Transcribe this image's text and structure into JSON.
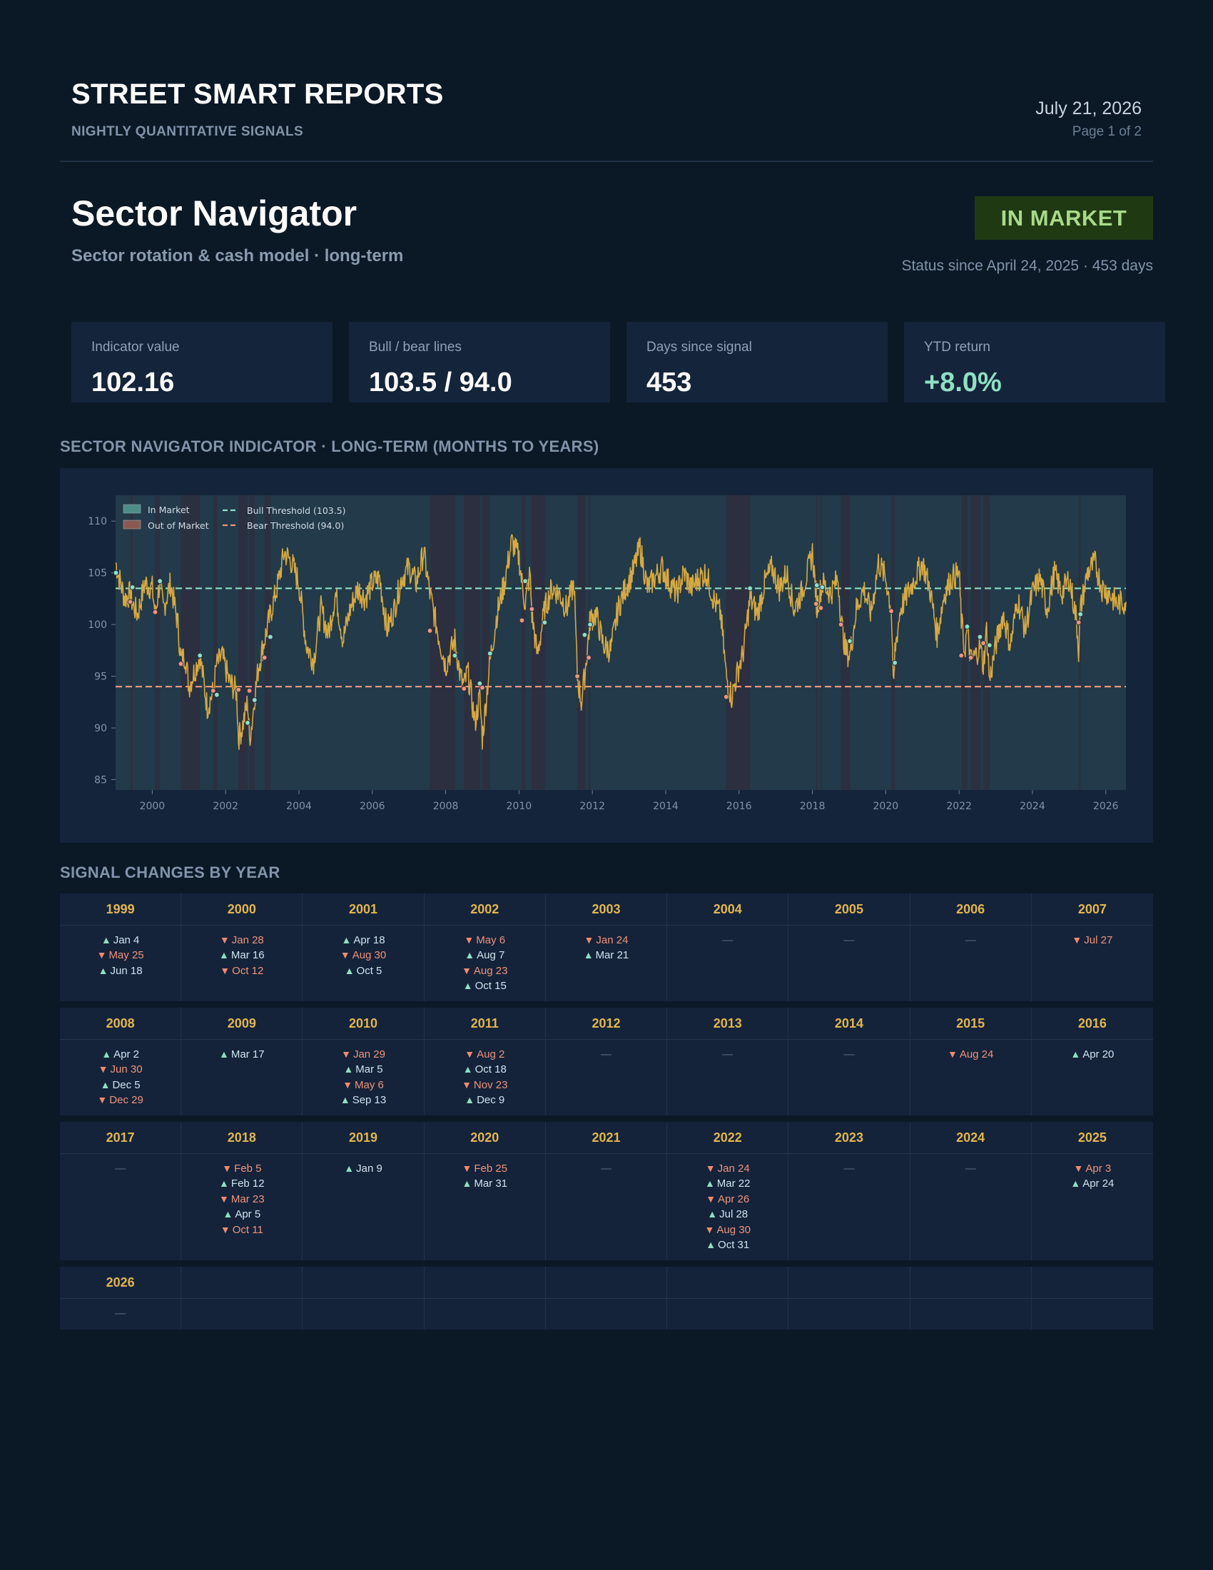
{
  "header": {
    "brand": "STREET SMART REPORTS",
    "brand_sub": "NIGHTLY QUANTITATIVE SIGNALS",
    "date": "July 21, 2026",
    "page": "Page 1 of 2"
  },
  "report": {
    "title": "Sector Navigator",
    "subtitle": "Sector rotation & cash model · long-term",
    "status": "IN MARKET",
    "status_since": "Status since April 24, 2025 · 453 days"
  },
  "kpis": [
    {
      "label": "Indicator value",
      "value": "102.16",
      "tone": "neutral"
    },
    {
      "label": "Bull / bear lines",
      "value": "103.5 / 94.0",
      "tone": "neutral"
    },
    {
      "label": "Days since signal",
      "value": "453",
      "tone": "neutral"
    },
    {
      "label": "YTD return",
      "value": "+8.0%",
      "tone": "positive"
    }
  ],
  "sections": {
    "chart_title": "SECTOR NAVIGATOR INDICATOR · LONG-TERM (MONTHS TO YEARS)",
    "signals_title": "SIGNAL CHANGES BY YEAR"
  },
  "colors": {
    "line": "#d7a93e",
    "bull": "#8fe0c2",
    "bear": "#f0937a",
    "in_market": "#223a4a",
    "out_market": "#2c2f3f"
  },
  "chart_data": {
    "type": "line",
    "xlim": [
      1999.0,
      2026.55
    ],
    "ylim": [
      84,
      112.5
    ],
    "yticks": [
      85,
      90,
      95,
      100,
      105,
      110
    ],
    "xticks": [
      2000,
      2002,
      2004,
      2006,
      2008,
      2010,
      2012,
      2014,
      2016,
      2018,
      2020,
      2022,
      2024,
      2026
    ],
    "thresholds": [
      {
        "name": "Bull Threshold (103.5)",
        "value": 103.5,
        "color": "#8fe0c2"
      },
      {
        "name": "Bear Threshold (94.0)",
        "value": 94.0,
        "color": "#f0937a"
      }
    ],
    "regions": [
      {
        "name": "In Market",
        "color": "#4f8c87"
      },
      {
        "name": "Out of Market",
        "color": "#8a5a52"
      }
    ],
    "out_of_market_periods": [
      [
        "1999-05-25",
        "1999-06-18"
      ],
      [
        "2000-01-28",
        "2000-03-16"
      ],
      [
        "2000-10-12",
        "2001-04-18"
      ],
      [
        "2001-08-30",
        "2001-10-05"
      ],
      [
        "2002-05-06",
        "2002-08-07"
      ],
      [
        "2002-08-23",
        "2002-10-15"
      ],
      [
        "2003-01-24",
        "2003-03-21"
      ],
      [
        "2007-07-27",
        "2008-04-02"
      ],
      [
        "2008-06-30",
        "2008-12-05"
      ],
      [
        "2008-12-29",
        "2009-03-17"
      ],
      [
        "2010-01-29",
        "2010-03-05"
      ],
      [
        "2010-05-06",
        "2010-09-13"
      ],
      [
        "2011-08-02",
        "2011-10-18"
      ],
      [
        "2011-11-23",
        "2011-12-09"
      ],
      [
        "2015-08-24",
        "2016-04-20"
      ],
      [
        "2018-02-05",
        "2018-02-12"
      ],
      [
        "2018-03-23",
        "2018-04-05"
      ],
      [
        "2018-10-11",
        "2019-01-09"
      ],
      [
        "2020-02-25",
        "2020-03-31"
      ],
      [
        "2022-01-24",
        "2022-03-22"
      ],
      [
        "2022-04-26",
        "2022-07-28"
      ],
      [
        "2022-08-30",
        "2022-10-31"
      ],
      [
        "2025-04-03",
        "2025-04-24"
      ]
    ],
    "series": [
      {
        "name": "",
        "color": "#d7a93e",
        "x": [
          1999.0,
          1999.1,
          1999.25,
          1999.4,
          1999.46,
          1999.6,
          1999.8,
          2000.0,
          2000.08,
          2000.2,
          2000.3,
          2000.5,
          2000.7,
          2000.78,
          2000.9,
          2001.0,
          2001.15,
          2001.3,
          2001.5,
          2001.66,
          2001.75,
          2001.9,
          2002.1,
          2002.3,
          2002.35,
          2002.45,
          2002.6,
          2002.65,
          2002.72,
          2002.79,
          2002.9,
          2003.06,
          2003.22,
          2003.4,
          2003.6,
          2003.8,
          2004.0,
          2004.2,
          2004.4,
          2004.6,
          2004.8,
          2005.0,
          2005.2,
          2005.4,
          2005.6,
          2005.8,
          2006.0,
          2006.2,
          2006.4,
          2006.6,
          2006.8,
          2007.0,
          2007.2,
          2007.4,
          2007.57,
          2007.8,
          2008.0,
          2008.25,
          2008.4,
          2008.5,
          2008.6,
          2008.8,
          2008.93,
          2009.0,
          2009.21,
          2009.4,
          2009.6,
          2009.8,
          2010.0,
          2010.08,
          2010.17,
          2010.3,
          2010.35,
          2010.5,
          2010.7,
          2010.9,
          2011.1,
          2011.3,
          2011.5,
          2011.59,
          2011.7,
          2011.79,
          2011.9,
          2011.94,
          2012.1,
          2012.3,
          2012.5,
          2012.7,
          2012.9,
          2013.1,
          2013.3,
          2013.5,
          2013.7,
          2013.9,
          2014.1,
          2014.3,
          2014.5,
          2014.7,
          2014.9,
          2015.1,
          2015.3,
          2015.5,
          2015.65,
          2015.8,
          2016.0,
          2016.1,
          2016.3,
          2016.5,
          2016.7,
          2016.9,
          2017.1,
          2017.3,
          2017.5,
          2017.7,
          2017.9,
          2018.0,
          2018.1,
          2018.12,
          2018.23,
          2018.27,
          2018.5,
          2018.7,
          2018.78,
          2018.9,
          2019.02,
          2019.2,
          2019.4,
          2019.6,
          2019.8,
          2020.0,
          2020.15,
          2020.22,
          2020.25,
          2020.4,
          2020.6,
          2020.8,
          2021.0,
          2021.2,
          2021.4,
          2021.6,
          2021.8,
          2022.0,
          2022.06,
          2022.15,
          2022.22,
          2022.32,
          2022.45,
          2022.57,
          2022.66,
          2022.75,
          2022.83,
          2023.0,
          2023.2,
          2023.4,
          2023.6,
          2023.8,
          2024.0,
          2024.2,
          2024.4,
          2024.6,
          2024.8,
          2025.0,
          2025.2,
          2025.26,
          2025.31,
          2025.5,
          2025.7,
          2025.9,
          2026.1,
          2026.3,
          2026.55
        ],
        "values": [
          106.0,
          104.5,
          102.5,
          103.0,
          102.0,
          101.0,
          104.0,
          103.5,
          101.0,
          104.0,
          101.5,
          104.0,
          100.0,
          96.5,
          97.0,
          94.0,
          95.5,
          97.0,
          92.0,
          93.5,
          96.0,
          97.0,
          94.5,
          93.5,
          89.0,
          90.0,
          92.5,
          89.0,
          90.5,
          93.0,
          96.0,
          98.5,
          101.0,
          103.5,
          107.0,
          106.0,
          104.0,
          98.0,
          96.5,
          101.5,
          99.0,
          103.0,
          98.5,
          101.5,
          103.5,
          102.5,
          104.0,
          104.5,
          99.5,
          101.5,
          104.5,
          105.5,
          104.0,
          107.0,
          103.0,
          99.0,
          96.0,
          98.5,
          95.0,
          94.0,
          95.5,
          90.5,
          93.0,
          89.0,
          96.5,
          101.0,
          104.0,
          108.0,
          106.5,
          104.0,
          102.0,
          105.0,
          101.0,
          97.0,
          101.5,
          103.5,
          103.0,
          101.5,
          104.0,
          95.0,
          92.5,
          95.0,
          99.0,
          100.5,
          101.0,
          98.0,
          97.5,
          101.5,
          103.5,
          105.0,
          107.5,
          103.5,
          104.5,
          105.5,
          104.0,
          103.0,
          105.0,
          103.5,
          104.5,
          105.0,
          102.5,
          101.0,
          95.0,
          93.0,
          96.0,
          97.0,
          102.5,
          101.0,
          104.0,
          105.5,
          103.5,
          105.0,
          101.5,
          103.0,
          105.5,
          107.0,
          103.0,
          101.5,
          103.5,
          104.0,
          103.0,
          104.5,
          100.5,
          97.5,
          97.0,
          101.5,
          103.5,
          101.0,
          106.0,
          104.5,
          101.5,
          93.5,
          97.5,
          101.5,
          103.0,
          104.5,
          106.0,
          103.5,
          99.0,
          103.0,
          104.5,
          105.0,
          100.5,
          97.5,
          99.5,
          96.5,
          97.0,
          98.0,
          96.0,
          99.5,
          94.5,
          98.0,
          101.0,
          98.0,
          102.5,
          99.5,
          103.0,
          104.5,
          101.5,
          105.0,
          103.0,
          104.5,
          100.5,
          97.5,
          101.5,
          105.0,
          106.0,
          103.5,
          103.0,
          102.0,
          102.2
        ]
      }
    ],
    "markers": [
      {
        "x": 1999.01,
        "y": 105.0,
        "dir": "up"
      },
      {
        "x": 1999.4,
        "y": 102.2,
        "dir": "down"
      },
      {
        "x": 1999.46,
        "y": 103.6,
        "dir": "up"
      },
      {
        "x": 2000.08,
        "y": 101.2,
        "dir": "down"
      },
      {
        "x": 2000.21,
        "y": 104.2,
        "dir": "up"
      },
      {
        "x": 2000.78,
        "y": 96.2,
        "dir": "down"
      },
      {
        "x": 2001.3,
        "y": 97.0,
        "dir": "up"
      },
      {
        "x": 2001.66,
        "y": 93.6,
        "dir": "down"
      },
      {
        "x": 2001.76,
        "y": 93.2,
        "dir": "up"
      },
      {
        "x": 2002.35,
        "y": 93.7,
        "dir": "down"
      },
      {
        "x": 2002.6,
        "y": 90.5,
        "dir": "up"
      },
      {
        "x": 2002.65,
        "y": 93.6,
        "dir": "down"
      },
      {
        "x": 2002.79,
        "y": 92.7,
        "dir": "up"
      },
      {
        "x": 2003.06,
        "y": 96.8,
        "dir": "down"
      },
      {
        "x": 2003.22,
        "y": 98.8,
        "dir": "up"
      },
      {
        "x": 2007.57,
        "y": 99.4,
        "dir": "down"
      },
      {
        "x": 2008.25,
        "y": 97.0,
        "dir": "up"
      },
      {
        "x": 2008.5,
        "y": 93.8,
        "dir": "down"
      },
      {
        "x": 2008.93,
        "y": 94.3,
        "dir": "up"
      },
      {
        "x": 2009.0,
        "y": 93.9,
        "dir": "down"
      },
      {
        "x": 2009.21,
        "y": 97.2,
        "dir": "up"
      },
      {
        "x": 2010.08,
        "y": 100.4,
        "dir": "down"
      },
      {
        "x": 2010.17,
        "y": 104.2,
        "dir": "up"
      },
      {
        "x": 2010.35,
        "y": 101.5,
        "dir": "down"
      },
      {
        "x": 2010.7,
        "y": 100.2,
        "dir": "up"
      },
      {
        "x": 2011.59,
        "y": 95.0,
        "dir": "down"
      },
      {
        "x": 2011.79,
        "y": 99.0,
        "dir": "up"
      },
      {
        "x": 2011.9,
        "y": 96.8,
        "dir": "down"
      },
      {
        "x": 2011.94,
        "y": 100.0,
        "dir": "up"
      },
      {
        "x": 2015.65,
        "y": 93.0,
        "dir": "down"
      },
      {
        "x": 2016.3,
        "y": 103.5,
        "dir": "up"
      },
      {
        "x": 2018.1,
        "y": 102.0,
        "dir": "down"
      },
      {
        "x": 2018.12,
        "y": 103.8,
        "dir": "up"
      },
      {
        "x": 2018.23,
        "y": 101.6,
        "dir": "down"
      },
      {
        "x": 2018.27,
        "y": 103.6,
        "dir": "up"
      },
      {
        "x": 2018.78,
        "y": 100.0,
        "dir": "down"
      },
      {
        "x": 2019.02,
        "y": 98.4,
        "dir": "up"
      },
      {
        "x": 2020.15,
        "y": 101.3,
        "dir": "down"
      },
      {
        "x": 2020.25,
        "y": 96.3,
        "dir": "up"
      },
      {
        "x": 2022.06,
        "y": 97.0,
        "dir": "down"
      },
      {
        "x": 2022.22,
        "y": 99.8,
        "dir": "up"
      },
      {
        "x": 2022.32,
        "y": 96.8,
        "dir": "down"
      },
      {
        "x": 2022.57,
        "y": 98.8,
        "dir": "up"
      },
      {
        "x": 2022.66,
        "y": 98.2,
        "dir": "down"
      },
      {
        "x": 2022.83,
        "y": 98.0,
        "dir": "up"
      },
      {
        "x": 2025.26,
        "y": 100.2,
        "dir": "down"
      },
      {
        "x": 2025.31,
        "y": 101.0,
        "dir": "up"
      }
    ],
    "legend_position": "top-left",
    "grid": false
  },
  "signals": [
    {
      "year": "1999",
      "events": [
        {
          "dir": "up",
          "date": "Jan 4"
        },
        {
          "dir": "down",
          "date": "May 25"
        },
        {
          "dir": "up",
          "date": "Jun 18"
        }
      ]
    },
    {
      "year": "2000",
      "events": [
        {
          "dir": "down",
          "date": "Jan 28"
        },
        {
          "dir": "up",
          "date": "Mar 16"
        },
        {
          "dir": "down",
          "date": "Oct 12"
        }
      ]
    },
    {
      "year": "2001",
      "events": [
        {
          "dir": "up",
          "date": "Apr 18"
        },
        {
          "dir": "down",
          "date": "Aug 30"
        },
        {
          "dir": "up",
          "date": "Oct 5"
        }
      ]
    },
    {
      "year": "2002",
      "events": [
        {
          "dir": "down",
          "date": "May 6"
        },
        {
          "dir": "up",
          "date": "Aug 7"
        },
        {
          "dir": "down",
          "date": "Aug 23"
        },
        {
          "dir": "up",
          "date": "Oct 15"
        }
      ]
    },
    {
      "year": "2003",
      "events": [
        {
          "dir": "down",
          "date": "Jan 24"
        },
        {
          "dir": "up",
          "date": "Mar 21"
        }
      ]
    },
    {
      "year": "2004",
      "events": []
    },
    {
      "year": "2005",
      "events": []
    },
    {
      "year": "2006",
      "events": []
    },
    {
      "year": "2007",
      "events": [
        {
          "dir": "down",
          "date": "Jul 27"
        }
      ]
    },
    {
      "year": "2008",
      "events": [
        {
          "dir": "up",
          "date": "Apr 2"
        },
        {
          "dir": "down",
          "date": "Jun 30"
        },
        {
          "dir": "up",
          "date": "Dec 5"
        },
        {
          "dir": "down",
          "date": "Dec 29"
        }
      ]
    },
    {
      "year": "2009",
      "events": [
        {
          "dir": "up",
          "date": "Mar 17"
        }
      ]
    },
    {
      "year": "2010",
      "events": [
        {
          "dir": "down",
          "date": "Jan 29"
        },
        {
          "dir": "up",
          "date": "Mar 5"
        },
        {
          "dir": "down",
          "date": "May 6"
        },
        {
          "dir": "up",
          "date": "Sep 13"
        }
      ]
    },
    {
      "year": "2011",
      "events": [
        {
          "dir": "down",
          "date": "Aug 2"
        },
        {
          "dir": "up",
          "date": "Oct 18"
        },
        {
          "dir": "down",
          "date": "Nov 23"
        },
        {
          "dir": "up",
          "date": "Dec 9"
        }
      ]
    },
    {
      "year": "2012",
      "events": []
    },
    {
      "year": "2013",
      "events": []
    },
    {
      "year": "2014",
      "events": []
    },
    {
      "year": "2015",
      "events": [
        {
          "dir": "down",
          "date": "Aug 24"
        }
      ]
    },
    {
      "year": "2016",
      "events": [
        {
          "dir": "up",
          "date": "Apr 20"
        }
      ]
    },
    {
      "year": "2017",
      "events": []
    },
    {
      "year": "2018",
      "events": [
        {
          "dir": "down",
          "date": "Feb 5"
        },
        {
          "dir": "up",
          "date": "Feb 12"
        },
        {
          "dir": "down",
          "date": "Mar 23"
        },
        {
          "dir": "up",
          "date": "Apr 5"
        },
        {
          "dir": "down",
          "date": "Oct 11"
        }
      ]
    },
    {
      "year": "2019",
      "events": [
        {
          "dir": "up",
          "date": "Jan 9"
        }
      ]
    },
    {
      "year": "2020",
      "events": [
        {
          "dir": "down",
          "date": "Feb 25"
        },
        {
          "dir": "up",
          "date": "Mar 31"
        }
      ]
    },
    {
      "year": "2021",
      "events": []
    },
    {
      "year": "2022",
      "events": [
        {
          "dir": "down",
          "date": "Jan 24"
        },
        {
          "dir": "up",
          "date": "Mar 22"
        },
        {
          "dir": "down",
          "date": "Apr 26"
        },
        {
          "dir": "up",
          "date": "Jul 28"
        },
        {
          "dir": "down",
          "date": "Aug 30"
        },
        {
          "dir": "up",
          "date": "Oct 31"
        }
      ]
    },
    {
      "year": "2023",
      "events": []
    },
    {
      "year": "2024",
      "events": []
    },
    {
      "year": "2025",
      "events": [
        {
          "dir": "down",
          "date": "Apr 3"
        },
        {
          "dir": "up",
          "date": "Apr 24"
        }
      ]
    },
    {
      "year": "2026",
      "events": []
    }
  ],
  "empty_marker": "—"
}
